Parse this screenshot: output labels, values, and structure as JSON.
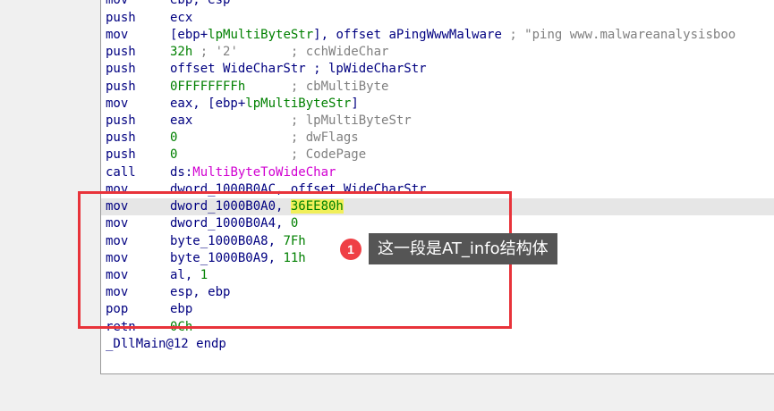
{
  "listing": {
    "lines": [
      {
        "mnemonic": "mov",
        "operand": "ebp, esp"
      },
      {
        "mnemonic": "push",
        "operand": "ecx"
      },
      {
        "mnemonic": "mov",
        "operand_a": "[ebp+",
        "operand_b": "lpMultiByteStr",
        "operand_c": "], offset aPingWwwMalware",
        "comment": " ; \"ping www.malwareanalysisboo"
      },
      {
        "mnemonic": "push",
        "operand": "32h",
        "comment": " ; '2'       ; cchWideChar"
      },
      {
        "mnemonic": "push",
        "operand": "offset WideCharStr ; lpWideCharStr"
      },
      {
        "mnemonic": "push",
        "operand": "0FFFFFFFFh",
        "comment": "      ; cbMultiByte"
      },
      {
        "mnemonic": "mov",
        "operand_a": "eax, [ebp+",
        "operand_b": "lpMultiByteStr",
        "operand_c": "]"
      },
      {
        "mnemonic": "push",
        "operand": "eax",
        "comment": "             ; lpMultiByteStr"
      },
      {
        "mnemonic": "push",
        "operand": "0",
        "comment": "               ; dwFlags"
      },
      {
        "mnemonic": "push",
        "operand": "0",
        "comment": "               ; CodePage"
      },
      {
        "mnemonic": "call",
        "operand_a": "ds:",
        "operand_b": "MultiByteToWideChar"
      },
      {
        "mnemonic": "mov",
        "operand": "dword_1000B0AC, offset WideCharStr"
      },
      {
        "mnemonic": "mov",
        "operand_a": "dword_1000B0A0, ",
        "operand_hl": "36EE80h"
      },
      {
        "mnemonic": "mov",
        "operand_a": "dword_1000B0A4, ",
        "operand_g": "0"
      },
      {
        "mnemonic": "mov",
        "operand_a": "byte_1000B0A8, ",
        "operand_g": "7Fh"
      },
      {
        "mnemonic": "mov",
        "operand_a": "byte_1000B0A9, ",
        "operand_g": "11h"
      },
      {
        "mnemonic": "mov",
        "operand_a": "al, ",
        "operand_g": "1"
      },
      {
        "mnemonic": "mov",
        "operand": "esp, ebp"
      },
      {
        "mnemonic": "pop",
        "operand": "ebp"
      },
      {
        "mnemonic": "retn",
        "operand_g": "0Ch"
      },
      {
        "label": "_DllMain@12 endp"
      }
    ]
  },
  "annotation": {
    "badge": "1",
    "text": "这一段是AT_info结构体",
    "box_color": "#e8333a",
    "badge_color": "#ef3f45"
  },
  "colors": {
    "code_text": "#000080",
    "comment": "#808080",
    "immediate": "#008000",
    "import": "#d100d1",
    "highlight_token": "#f1ef5a",
    "current_line": "#e6e6e6"
  }
}
